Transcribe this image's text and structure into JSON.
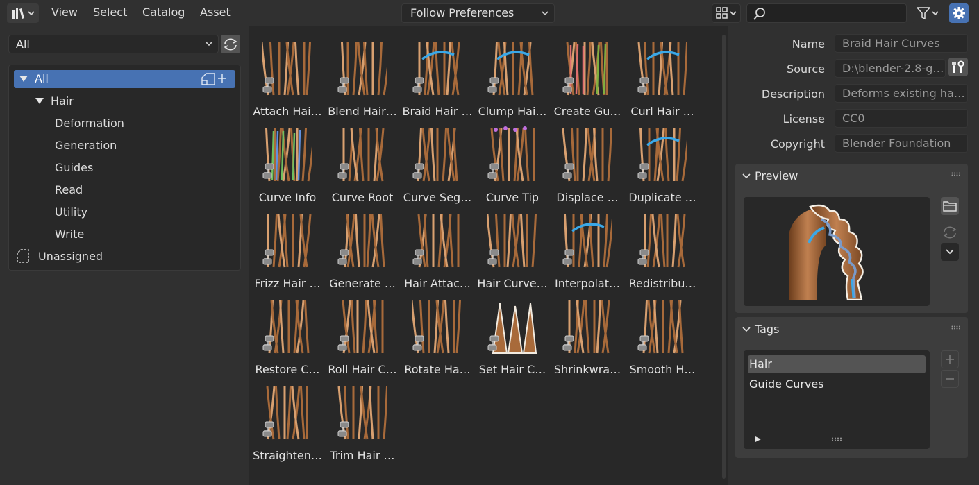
{
  "header": {
    "editor_type_icon": "asset-browser-icon",
    "menus": [
      "View",
      "Select",
      "Catalog",
      "Asset"
    ],
    "import_method": "Follow Preferences",
    "search_placeholder": ""
  },
  "left_panel": {
    "library": "All",
    "catalog_tree": [
      {
        "label": "All",
        "depth": 0,
        "expanded": true,
        "active": true
      },
      {
        "label": "Hair",
        "depth": 1,
        "expanded": true,
        "active": false
      },
      {
        "label": "Deformation",
        "depth": 2
      },
      {
        "label": "Generation",
        "depth": 2
      },
      {
        "label": "Guides",
        "depth": 2
      },
      {
        "label": "Read",
        "depth": 2
      },
      {
        "label": "Utility",
        "depth": 2
      },
      {
        "label": "Write",
        "depth": 2
      },
      {
        "label": "Unassigned",
        "depth": 0,
        "icon": "unassigned-icon"
      }
    ]
  },
  "assets": [
    {
      "label": "Attach Hai…",
      "icon": "hair-attach-thumbnail"
    },
    {
      "label": "Blend Hair…",
      "icon": "hair-blend-thumbnail"
    },
    {
      "label": "Braid Hair …",
      "icon": "hair-braid-thumbnail"
    },
    {
      "label": "Clump Hai…",
      "icon": "hair-clump-thumbnail"
    },
    {
      "label": "Create Gu…",
      "icon": "hair-guides-thumbnail"
    },
    {
      "label": "Curl Hair …",
      "icon": "hair-curl-thumbnail"
    },
    {
      "label": "Curve Info",
      "icon": "hair-info-thumbnail"
    },
    {
      "label": "Curve Root",
      "icon": "hair-root-thumbnail"
    },
    {
      "label": "Curve Seg…",
      "icon": "hair-segment-thumbnail"
    },
    {
      "label": "Curve Tip",
      "icon": "hair-tip-thumbnail"
    },
    {
      "label": "Displace …",
      "icon": "hair-displace-thumbnail"
    },
    {
      "label": "Duplicate …",
      "icon": "hair-duplicate-thumbnail"
    },
    {
      "label": "Frizz Hair …",
      "icon": "hair-frizz-thumbnail"
    },
    {
      "label": "Generate …",
      "icon": "hair-generate-thumbnail"
    },
    {
      "label": "Hair Attac…",
      "icon": "hair-attachment-thumbnail"
    },
    {
      "label": "Hair Curve…",
      "icon": "hair-curves-thumbnail"
    },
    {
      "label": "Interpolat…",
      "icon": "hair-interpolate-thumbnail"
    },
    {
      "label": "Redistribu…",
      "icon": "hair-redistribute-thumbnail"
    },
    {
      "label": "Restore C…",
      "icon": "hair-restore-thumbnail"
    },
    {
      "label": "Roll Hair C…",
      "icon": "hair-roll-thumbnail"
    },
    {
      "label": "Rotate Ha…",
      "icon": "hair-rotate-thumbnail"
    },
    {
      "label": "Set Hair C…",
      "icon": "hair-set-thumbnail"
    },
    {
      "label": "Shrinkwra…",
      "icon": "hair-shrinkwrap-thumbnail"
    },
    {
      "label": "Smooth H…",
      "icon": "hair-smooth-thumbnail"
    },
    {
      "label": "Straighten…",
      "icon": "hair-straighten-thumbnail"
    },
    {
      "label": "Trim Hair …",
      "icon": "hair-trim-thumbnail"
    }
  ],
  "details": {
    "name_label": "Name",
    "name_value": "Braid Hair Curves",
    "source_label": "Source",
    "source_value": "D:\\blender-2.8-g…",
    "description_label": "Description",
    "description_value": "Deforms existing ha…",
    "license_label": "License",
    "license_value": "CC0",
    "copyright_label": "Copyright",
    "copyright_value": "Blender Foundation"
  },
  "preview_panel": {
    "title": "Preview"
  },
  "tags_panel": {
    "title": "Tags",
    "tags": [
      {
        "label": "Hair",
        "active": true
      },
      {
        "label": "Guide Curves",
        "active": false
      }
    ]
  },
  "colors": {
    "accent": "#4772b3",
    "hair": "#a86a3a",
    "hair_light": "#d8a070",
    "highlight_blue": "#3aa8e8"
  }
}
